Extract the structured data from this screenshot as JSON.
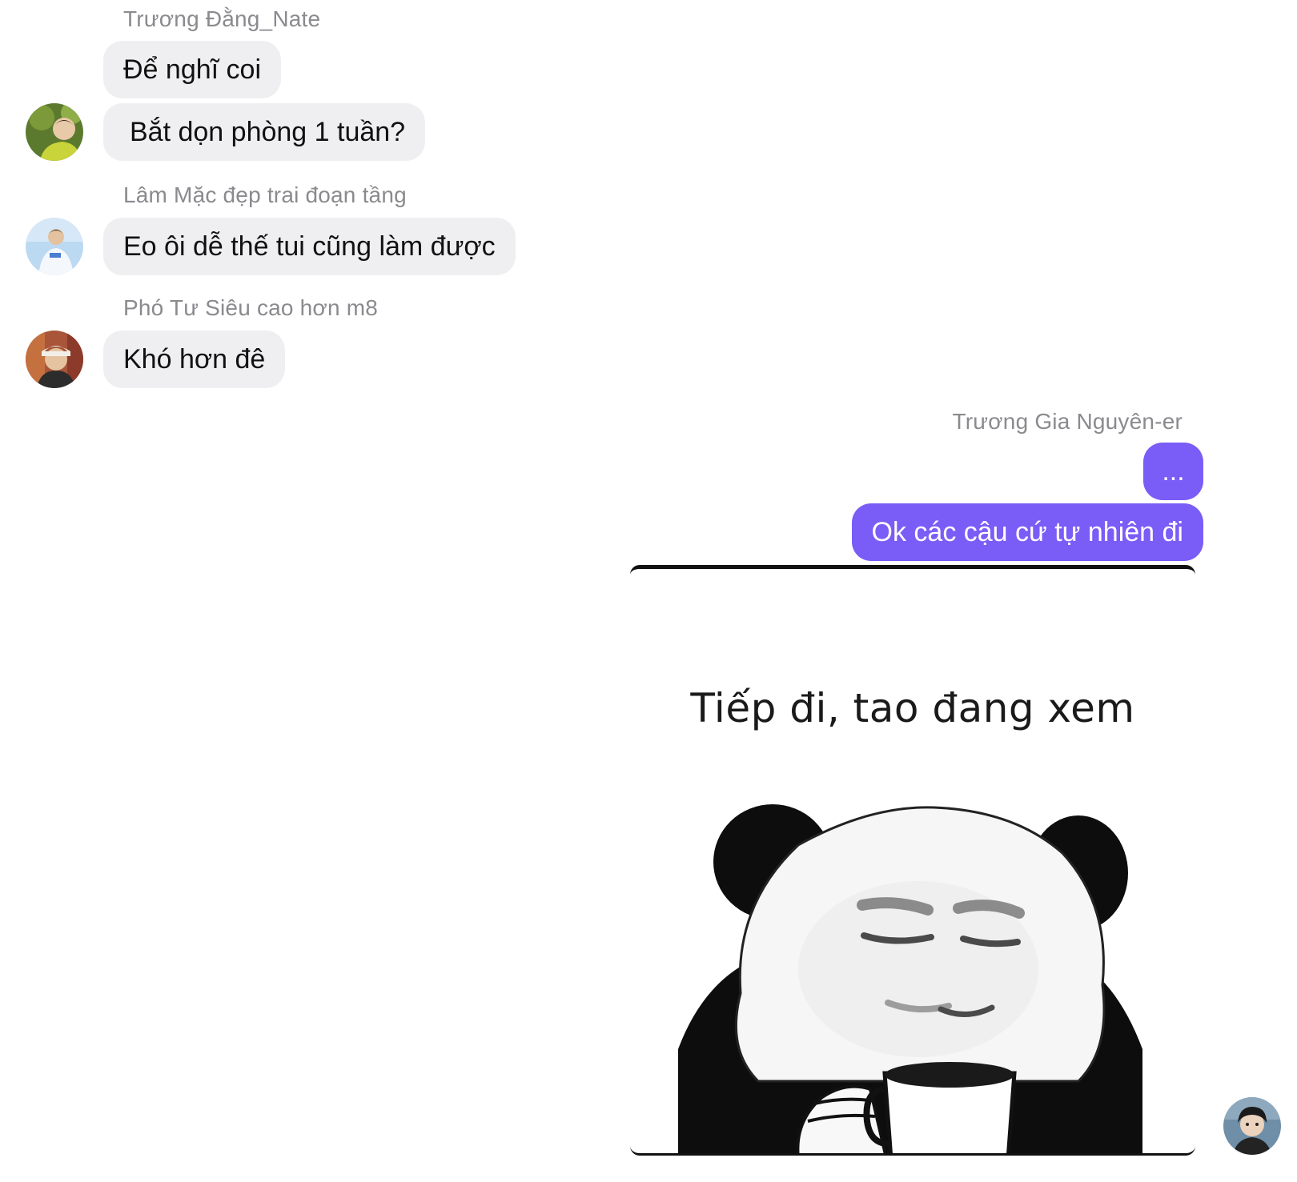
{
  "messages": [
    {
      "sender": "Trương Đằng_Nate",
      "bubbles": [
        "Để nghĩ coi",
        "Bắt dọn phòng 1 tuần?"
      ]
    },
    {
      "sender": "Lâm Mặc đẹp trai đoạn tầng",
      "bubbles": [
        "Eo ôi dễ thế tui cũng làm được"
      ]
    },
    {
      "sender": "Phó Tư Siêu cao hơn m8",
      "bubbles": [
        "Khó hơn đê"
      ]
    },
    {
      "sender": "Trương Gia Nguyên-er",
      "bubbles": [
        "...",
        "Ok các cậu cứ tự nhiên đi"
      ],
      "sticker_caption": "Tiếp đi, tao đang xem"
    }
  ],
  "colors": {
    "outgoing_bubble": "#7a5cf7",
    "incoming_bubble": "#efeff1",
    "sender_name": "#8a8a8f"
  },
  "icons": [
    "avatar-photo",
    "panda-meme-sticker"
  ]
}
